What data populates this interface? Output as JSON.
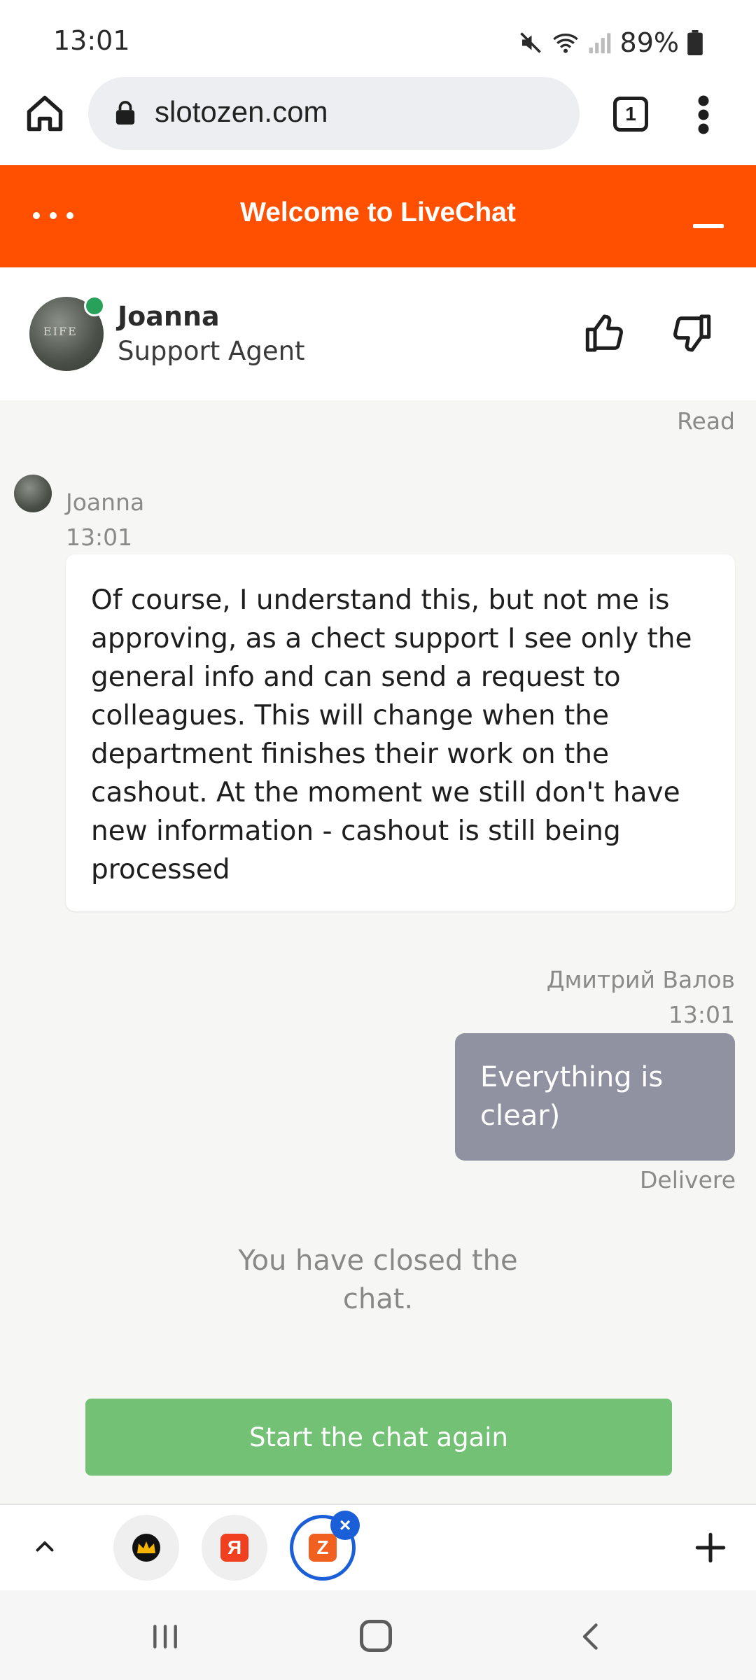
{
  "status_bar": {
    "time": "13:01",
    "battery": "89%"
  },
  "browser": {
    "url": "slotozen.com",
    "tab_count": "1"
  },
  "livechat": {
    "title": "Welcome to LiveChat",
    "agent": {
      "name": "Joanna",
      "role": "Support Agent",
      "avatar_text": "EIFE"
    }
  },
  "chat": {
    "read_status": "Read",
    "agent_message": {
      "author": "Joanna",
      "time": "13:01",
      "text": "Of course, I understand this, but not me is approving, as a chect support I see only the general info and can send a request to colleagues. This will change when the department finishes their work on the cashout. At the moment we still don't have new information - cashout is still being processed"
    },
    "user_message": {
      "author": "Дмитрий Валов",
      "time": "13:01",
      "text": "Everything is clear)",
      "status": "Delivered"
    },
    "closed_note": "You have closed the chat.",
    "restart_button": "Start the chat again"
  },
  "tab_strip": {
    "tabs": [
      {
        "icon": "crown-icon",
        "letter": ""
      },
      {
        "icon": "yandex-icon",
        "letter": "Я"
      },
      {
        "icon": "slotozen-icon",
        "letter": "Z"
      }
    ]
  },
  "colors": {
    "brand": "#fe5000",
    "restart": "#72c174",
    "user_bubble": "#9092a1",
    "online": "#28a15a",
    "active_tab": "#1b5fd8"
  }
}
